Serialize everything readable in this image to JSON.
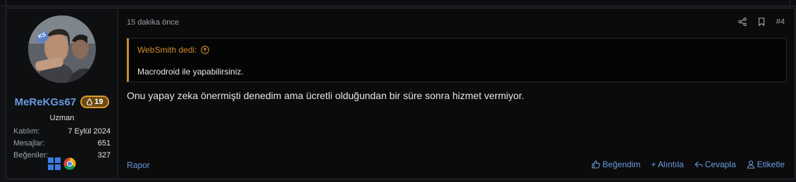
{
  "post": {
    "timestamp": "15 dakika önce",
    "post_number": "#4",
    "quote": {
      "author_line": "WebSmith dedi:",
      "text": "Macrodroid ile yapabilirsiniz."
    },
    "message": "Onu yapay zeka önermişti denedim ama ücretli olduğundan bir süre sonra hizmet vermiyor.",
    "report_label": "Rapor",
    "actions": {
      "like": "Beğendim",
      "quote": "+ Alıntıla",
      "reply": "Cevapla",
      "tag": "Etiketle"
    }
  },
  "user": {
    "avatar_badge": "KS",
    "name": "MeReKGs67",
    "reputation": "19",
    "title": "Uzman",
    "stats": [
      {
        "label": "Katılım:",
        "value": "7 Eylül 2024"
      },
      {
        "label": "Mesajlar:",
        "value": "651"
      },
      {
        "label": "Beğeniler:",
        "value": "327"
      }
    ],
    "os_icons": [
      "windows-icon",
      "chrome-icon"
    ]
  },
  "colors": {
    "background": "#111214",
    "link": "#6b9be0",
    "quote_accent": "#d08a2c",
    "badge_border": "#d99a2b",
    "badge_fill": "#6b4a12"
  }
}
